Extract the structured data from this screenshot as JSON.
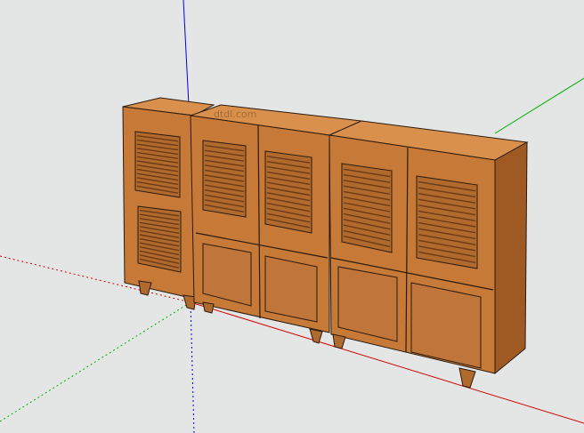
{
  "viewport": {
    "background": "#e4e6e6",
    "axes": {
      "red_axis": "#d40000",
      "green_axis": "#00b000",
      "blue_axis": "#0000dd"
    },
    "watermark": "dtdl.com"
  },
  "model": {
    "wood_front": "#c77a38",
    "wood_side": "#9e5a22",
    "wood_top": "#d9904c",
    "outline": "#2a1a0d",
    "louver": "#6e3a14"
  }
}
